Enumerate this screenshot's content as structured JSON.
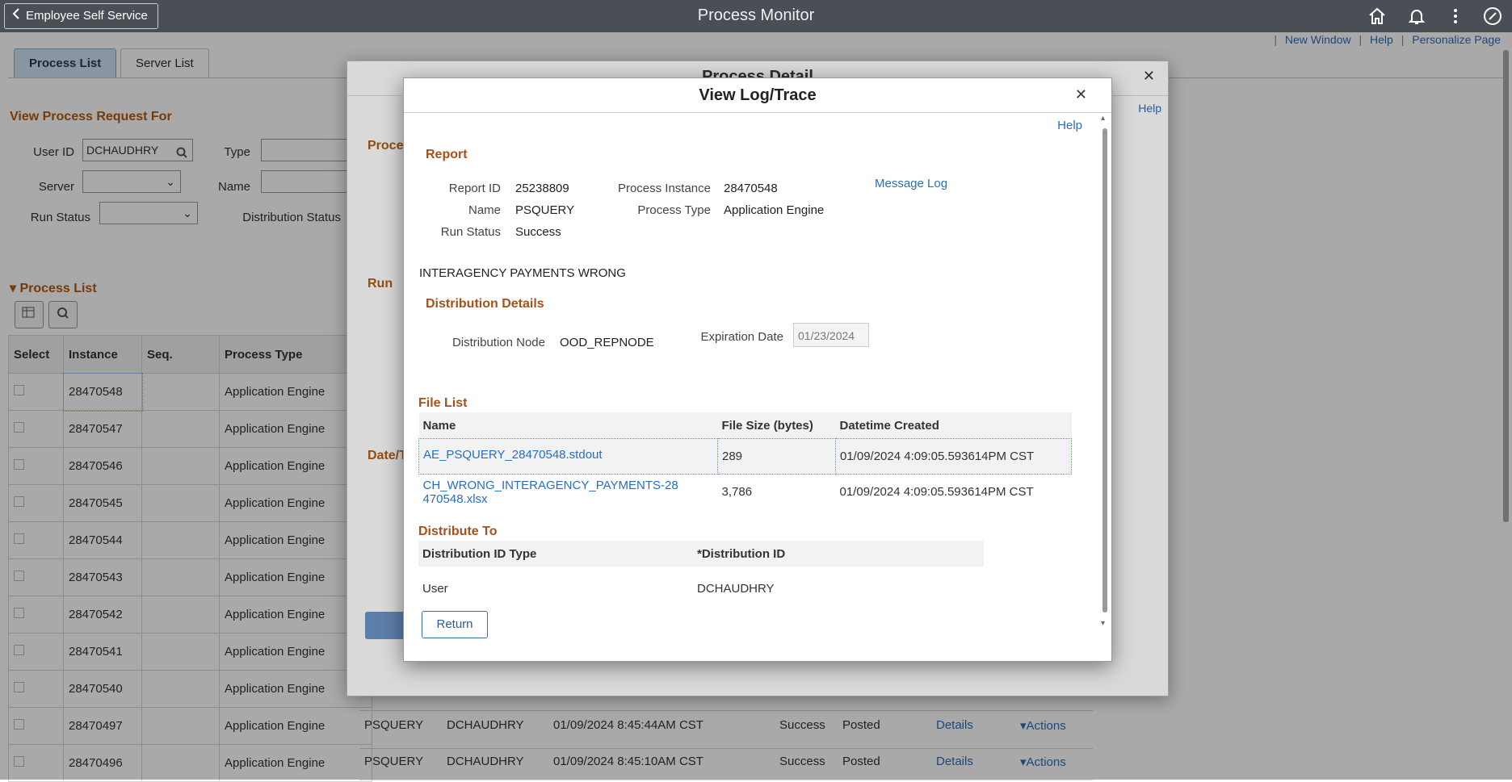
{
  "topbar": {
    "back_label": "Employee Self Service",
    "title": "Process Monitor",
    "icons": [
      "home-icon",
      "bell-icon",
      "more-vert-icon",
      "compass-icon"
    ]
  },
  "links": {
    "new_window": "New Window",
    "help": "Help",
    "personalize": "Personalize Page"
  },
  "tabs": [
    {
      "label": "Process List"
    },
    {
      "label": "Server List"
    }
  ],
  "filter": {
    "heading": "View Process Request For",
    "user_id_label": "User ID",
    "user_id_value": "DCHAUDHRY",
    "type_label": "Type",
    "server_label": "Server",
    "name_label": "Name",
    "run_status_label": "Run Status",
    "distribution_status_label": "Distribution Status"
  },
  "process_list": {
    "heading": "Process List",
    "columns": [
      "Select",
      "Instance",
      "Seq.",
      "Process Type"
    ],
    "rows": [
      {
        "instance": "28470548",
        "type": "Application Engine"
      },
      {
        "instance": "28470547",
        "type": "Application Engine"
      },
      {
        "instance": "28470546",
        "type": "Application Engine"
      },
      {
        "instance": "28470545",
        "type": "Application Engine"
      },
      {
        "instance": "28470544",
        "type": "Application Engine"
      },
      {
        "instance": "28470543",
        "type": "Application Engine"
      },
      {
        "instance": "28470542",
        "type": "Application Engine"
      },
      {
        "instance": "28470541",
        "type": "Application Engine"
      },
      {
        "instance": "28470540",
        "type": "Application Engine"
      },
      {
        "instance": "28470497",
        "type": "Application Engine",
        "name": "PSQUERY",
        "user": "DCHAUDHRY",
        "datetime": "01/09/2024 8:45:44AM CST",
        "run_status": "Success",
        "dist_status": "Posted",
        "details": "Details",
        "actions": "Actions"
      },
      {
        "instance": "28470496",
        "type": "Application Engine",
        "name": "PSQUERY",
        "user": "DCHAUDHRY",
        "datetime": "01/09/2024 8:45:10AM CST",
        "run_status": "Success",
        "dist_status": "Posted",
        "details": "Details",
        "actions": "Actions"
      }
    ]
  },
  "process_detail": {
    "title": "Process Detail",
    "help": "Help",
    "process_label": "Proce",
    "run_label": "Run",
    "date_label": "Date/T"
  },
  "log_trace": {
    "title": "View Log/Trace",
    "help": "Help",
    "report_heading": "Report",
    "report_id_label": "Report ID",
    "report_id": "25238809",
    "process_instance_label": "Process Instance",
    "process_instance": "28470548",
    "message_log": "Message Log",
    "name_label": "Name",
    "name": "PSQUERY",
    "process_type_label": "Process Type",
    "process_type": "Application Engine",
    "run_status_label": "Run Status",
    "run_status": "Success",
    "description": "INTERAGENCY PAYMENTS WRONG",
    "distribution_heading": "Distribution Details",
    "distribution_node_label": "Distribution Node",
    "distribution_node": "OOD_REPNODE",
    "expiration_date_label": "Expiration Date",
    "expiration_date": "01/23/2024",
    "file_list_heading": "File List",
    "file_columns": [
      "Name",
      "File Size (bytes)",
      "Datetime Created"
    ],
    "files": [
      {
        "name": "AE_PSQUERY_28470548.stdout",
        "size": "289",
        "created": "01/09/2024  4:09:05.593614PM CST"
      },
      {
        "name": "CH_WRONG_INTERAGENCY_PAYMENTS-28470548.xlsx",
        "size": "3,786",
        "created": "01/09/2024  4:09:05.593614PM CST"
      }
    ],
    "distribute_to_heading": "Distribute To",
    "distribute_columns": [
      "Distribution ID Type",
      "*Distribution ID"
    ],
    "distribute_rows": [
      {
        "type": "User",
        "id": "DCHAUDHRY"
      }
    ],
    "return_label": "Return"
  }
}
